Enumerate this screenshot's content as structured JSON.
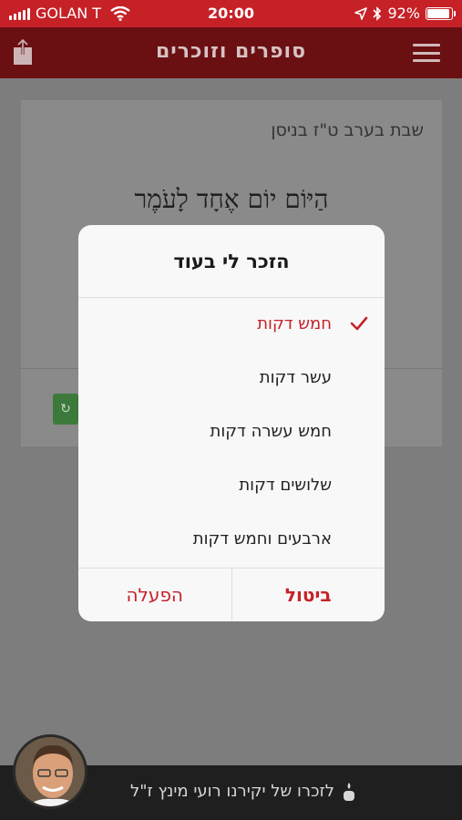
{
  "status_bar": {
    "carrier": "GOLAN T",
    "time": "20:00",
    "battery": "92%",
    "battery_level": 0.92
  },
  "header": {
    "title": "סופרים וזוכרים",
    "menu_icon": "hamburger-menu-icon",
    "share_icon": "share-icon"
  },
  "card": {
    "date": "שבת בערב ט\"ז בניסן",
    "omer_text": "הַיּוֹם יוֹם אֶחָד לָעֹמֶר"
  },
  "modal": {
    "title": "הזכר לי בעוד",
    "options": [
      {
        "label": "חמש דקות",
        "selected": true
      },
      {
        "label": "עשר דקות",
        "selected": false
      },
      {
        "label": "חמש עשרה דקות",
        "selected": false
      },
      {
        "label": "שלושים דקות",
        "selected": false
      },
      {
        "label": "ארבעים וחמש דקות",
        "selected": false
      }
    ],
    "cancel_label": "ביטול",
    "activate_label": "הפעלה"
  },
  "footer": {
    "memorial_text": "לזכרו של יקירנו רועי מינץ ז\"ל"
  },
  "colors": {
    "accent": "#c62127",
    "overlay": "#7d7d7d",
    "modal_bg": "#f8f8f8"
  }
}
